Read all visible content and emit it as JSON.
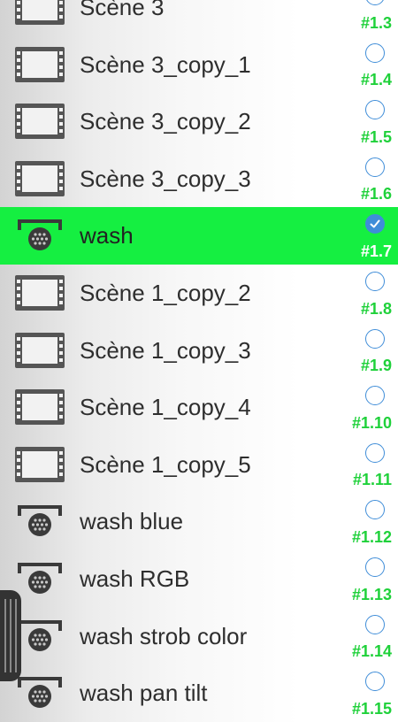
{
  "colors": {
    "selected_row_bg": "#15ef41",
    "cue_number": "#1fd13a",
    "radio": "#3f8dd8",
    "label_text": "#2e2e2e"
  },
  "list": {
    "items": [
      {
        "label": "Scène 3",
        "number": "#1.3",
        "icon": "film-icon",
        "checked": false
      },
      {
        "label": "Scène 3_copy_1",
        "number": "#1.4",
        "icon": "film-icon",
        "checked": false
      },
      {
        "label": "Scène 3_copy_2",
        "number": "#1.5",
        "icon": "film-icon",
        "checked": false
      },
      {
        "label": "Scène 3_copy_3",
        "number": "#1.6",
        "icon": "film-icon",
        "checked": false
      },
      {
        "label": "wash",
        "number": "#1.7",
        "icon": "wash-light-icon",
        "checked": true
      },
      {
        "label": "Scène 1_copy_2",
        "number": "#1.8",
        "icon": "film-icon",
        "checked": false
      },
      {
        "label": "Scène 1_copy_3",
        "number": "#1.9",
        "icon": "film-icon",
        "checked": false
      },
      {
        "label": "Scène 1_copy_4",
        "number": "#1.10",
        "icon": "film-icon",
        "checked": false
      },
      {
        "label": "Scène 1_copy_5",
        "number": "#1.11",
        "icon": "film-icon",
        "checked": false
      },
      {
        "label": "wash blue",
        "number": "#1.12",
        "icon": "wash-light-icon",
        "checked": false
      },
      {
        "label": "wash RGB",
        "number": "#1.13",
        "icon": "wash-light-icon",
        "checked": false
      },
      {
        "label": "wash strob color",
        "number": "#1.14",
        "icon": "wash-light-icon",
        "checked": false
      },
      {
        "label": "wash pan tilt",
        "number": "#1.15",
        "icon": "wash-light-icon",
        "checked": false
      }
    ]
  }
}
